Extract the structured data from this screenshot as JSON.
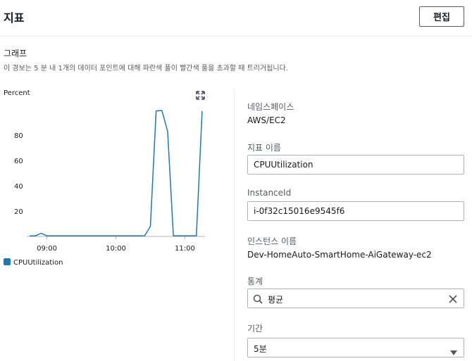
{
  "header": {
    "title": "지표",
    "edit_label": "편집"
  },
  "graph_section": {
    "title": "그래프",
    "description": "이 경보는 5 분 내 1개의 데이터 포인트에 대해 파란색 풀이 빨간색 풀을 초과할 때 트리거됩니다."
  },
  "chart_data": {
    "type": "line",
    "ylabel": "Percent",
    "ylim": [
      0,
      100
    ],
    "yticks": [
      20,
      40,
      60,
      80
    ],
    "xticks": [
      "09:00",
      "10:00",
      "11:00"
    ],
    "x": [
      "08:45",
      "08:50",
      "08:55",
      "09:00",
      "09:05",
      "09:10",
      "09:15",
      "09:20",
      "09:25",
      "09:30",
      "09:35",
      "09:40",
      "09:45",
      "09:50",
      "09:55",
      "10:00",
      "10:05",
      "10:10",
      "10:15",
      "10:20",
      "10:25",
      "10:30",
      "10:35",
      "10:40",
      "10:45",
      "10:50",
      "10:55",
      "11:00",
      "11:05",
      "11:10",
      "11:15"
    ],
    "series": [
      {
        "name": "CPUUtilization",
        "color": "#1f77b4",
        "values": [
          0.5,
          0.5,
          2.5,
          0.5,
          0.5,
          0.5,
          0.5,
          0.5,
          0.5,
          0.5,
          0.5,
          0.5,
          0.5,
          0.5,
          0.5,
          0.5,
          0.5,
          0.5,
          0.5,
          0.5,
          0.5,
          8,
          99,
          99.5,
          83,
          0.5,
          0.5,
          0.5,
          0.5,
          0.5,
          99
        ]
      }
    ],
    "legend": "bottom-left"
  },
  "details": {
    "namespace_label": "네임스페이스",
    "namespace_value": "AWS/EC2",
    "metric_name_label": "지표 이름",
    "metric_name_value": "CPUUtilization",
    "instance_id_label": "InstanceId",
    "instance_id_value": "i-0f32c15016e9545f6",
    "instance_name_label": "인스턴스 이름",
    "instance_name_value": "Dev-HomeAuto-SmartHome-AiGateway-ec2",
    "statistic_label": "통계",
    "statistic_value": "평균",
    "period_label": "기간",
    "period_value": "5분"
  },
  "icons": {
    "expand": "expand-icon",
    "search": "search-icon",
    "clear": "close-icon",
    "caret": "caret-down-icon"
  }
}
